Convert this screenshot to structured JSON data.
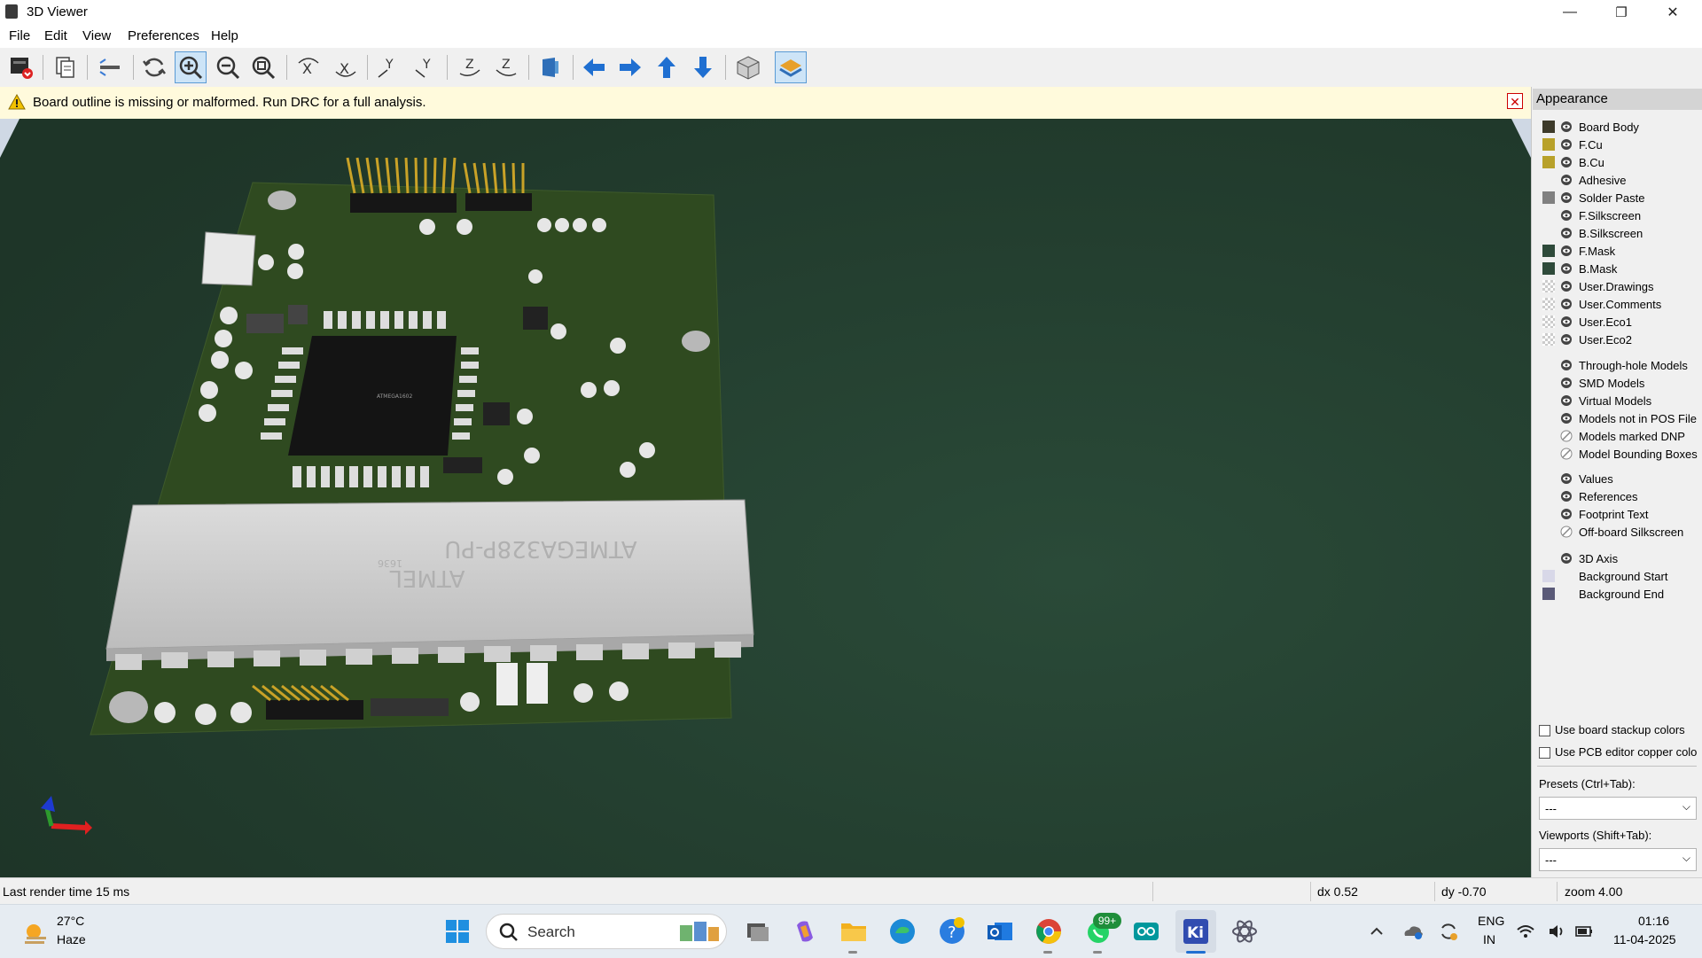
{
  "window": {
    "title": "3D Viewer",
    "minimize": "—",
    "maximize": "❐",
    "close": "✕"
  },
  "menu": [
    "File",
    "Edit",
    "View",
    "Preferences",
    "Help"
  ],
  "toolbar": {
    "buttons": [
      "render-raytrace",
      "copy-image",
      "flip-board",
      "reload",
      "zoom-in",
      "zoom-out",
      "zoom-fit",
      "rotate-x-cw",
      "rotate-x-ccw",
      "rotate-y-cw",
      "rotate-y-ccw",
      "rotate-z-cw",
      "rotate-z-ccw",
      "flip-view",
      "pan-left",
      "pan-right",
      "pan-up",
      "pan-down",
      "orthographic",
      "appearance"
    ],
    "active": [
      "zoom-in",
      "appearance"
    ]
  },
  "warning": {
    "message": "Board outline is missing or malformed. Run DRC for a full analysis."
  },
  "viewport": {
    "chip_text": "ATMEGA328P-PU",
    "chip_brand": "ATMEL",
    "chip_code": "1636",
    "mcu_text": "ATMEGA1602"
  },
  "appearance": {
    "title": "Appearance",
    "layers": [
      {
        "name": "Board Body",
        "color": "#3d3a2a",
        "eye": "visible"
      },
      {
        "name": "F.Cu",
        "color": "#b8a12a",
        "eye": "visible"
      },
      {
        "name": "B.Cu",
        "color": "#b8a12a",
        "eye": "visible"
      },
      {
        "name": "Adhesive",
        "color": "",
        "eye": "visible"
      },
      {
        "name": "Solder Paste",
        "color": "#808080",
        "eye": "visible"
      },
      {
        "name": "F.Silkscreen",
        "color": "#f0f0f0",
        "eye": "visible"
      },
      {
        "name": "B.Silkscreen",
        "color": "#f0f0f0",
        "eye": "visible"
      },
      {
        "name": "F.Mask",
        "color": "#2e4a3a",
        "eye": "visible"
      },
      {
        "name": "B.Mask",
        "color": "#2e4a3a",
        "eye": "visible"
      },
      {
        "name": "User.Drawings",
        "color": "checker",
        "eye": "visible"
      },
      {
        "name": "User.Comments",
        "color": "checker",
        "eye": "visible"
      },
      {
        "name": "User.Eco1",
        "color": "checker",
        "eye": "visible"
      },
      {
        "name": "User.Eco2",
        "color": "checker",
        "eye": "visible"
      }
    ],
    "models": [
      {
        "name": "Through-hole Models",
        "eye": "visible"
      },
      {
        "name": "SMD Models",
        "eye": "visible"
      },
      {
        "name": "Virtual Models",
        "eye": "visible"
      },
      {
        "name": "Models not in POS File",
        "eye": "visible"
      },
      {
        "name": "Models marked DNP",
        "eye": "hidden"
      },
      {
        "name": "Model Bounding Boxes",
        "eye": "hidden"
      }
    ],
    "texts": [
      {
        "name": "Values",
        "eye": "visible"
      },
      {
        "name": "References",
        "eye": "visible"
      },
      {
        "name": "Footprint Text",
        "eye": "visible"
      },
      {
        "name": "Off-board Silkscreen",
        "eye": "hidden"
      }
    ],
    "misc": [
      {
        "name": "3D Axis",
        "color": "",
        "eye": "visible"
      },
      {
        "name": "Background Start",
        "color": "#d8d8e8",
        "eye": ""
      },
      {
        "name": "Background End",
        "color": "#5a5a78",
        "eye": ""
      }
    ],
    "use_board_stackup": "Use board stackup colors",
    "use_pcb_editor": "Use PCB editor copper colo",
    "presets_label": "Presets (Ctrl+Tab):",
    "presets_value": "---",
    "viewports_label": "Viewports (Shift+Tab):",
    "viewports_value": "---"
  },
  "status": {
    "render_time": "Last render time 15 ms",
    "dx": "dx 0.52",
    "dy": "dy -0.70",
    "zoom": "zoom 4.00"
  },
  "taskbar": {
    "weather_temp": "27°C",
    "weather_desc": "Haze",
    "search_placeholder": "Search",
    "badge": "99+",
    "lang_top": "ENG",
    "lang_bottom": "IN",
    "time": "01:16",
    "date": "11-04-2025"
  }
}
